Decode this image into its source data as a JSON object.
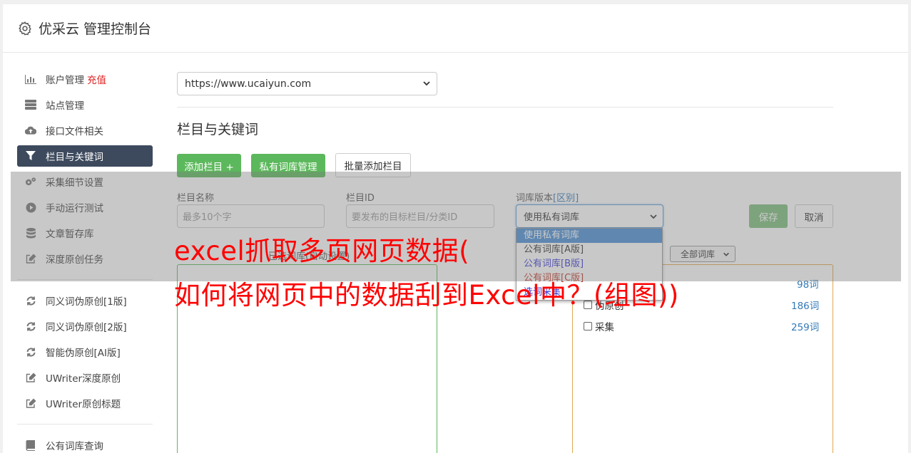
{
  "header": {
    "title": "优采云 管理控制台",
    "icon": "gear-icon"
  },
  "sidebar": {
    "group1": [
      {
        "label": "账户管理",
        "badge": "充值",
        "icon": "bar-chart-icon"
      },
      {
        "label": "站点管理",
        "icon": "server-icon"
      },
      {
        "label": "接口文件相关",
        "icon": "cloud-upload-icon"
      },
      {
        "label": "栏目与关键词",
        "icon": "filter-icon",
        "active": true
      },
      {
        "label": "采集细节设置",
        "icon": "gears-icon"
      },
      {
        "label": "手动运行测试",
        "icon": "play-circle-icon"
      },
      {
        "label": "文章暂存库",
        "icon": "database-icon"
      },
      {
        "label": "深度原创任务",
        "icon": "edit-icon"
      }
    ],
    "group2": [
      {
        "label": "同义词伪原创[1版]",
        "icon": "refresh-icon"
      },
      {
        "label": "同义词伪原创[2版]",
        "icon": "refresh-icon"
      },
      {
        "label": "智能伪原创[AI版]",
        "icon": "refresh-icon"
      },
      {
        "label": "UWriter深度原创",
        "icon": "edit-icon"
      },
      {
        "label": "UWriter原创标题",
        "icon": "edit-icon"
      }
    ],
    "group3": [
      {
        "label": "公有词库查询",
        "icon": "book-icon"
      }
    ]
  },
  "site_select": {
    "value": "https://www.ucaiyun.com"
  },
  "section": {
    "title": "栏目与关键词"
  },
  "buttons": {
    "add_column": "添加栏目 +",
    "private_lib": "私有词库管理",
    "batch_add": "批量添加栏目",
    "save": "保存",
    "cancel": "取消"
  },
  "form": {
    "name_label": "栏目名称",
    "name_placeholder": "最多10个字",
    "id_label": "栏目ID",
    "id_placeholder": "要发布的目标栏目/分类ID",
    "version_label": "词库版本",
    "version_link": "[区别]",
    "version_value": "使用私有词库",
    "version_options": [
      "使用私有词库",
      "公有词库[A版]",
      "公有词库[B版]",
      "公有词库[C版]",
      "选词采集"
    ]
  },
  "selected_panel": {
    "label": "已选词库(自动设置)"
  },
  "lib_filter": {
    "value": "全部词库"
  },
  "libraries": [
    {
      "name": "",
      "count": "98词"
    },
    {
      "name": "伪原创",
      "count": "186词"
    },
    {
      "name": "采集",
      "count": "259词"
    }
  ],
  "headline": {
    "line1": "excel抓取多页网页数据(",
    "line2": "如何将网页中的数据刮到Excel中？(组图))"
  },
  "colors": {
    "active_nav": "#3d4a5d",
    "green": "#5cb85c",
    "headline": "#ff0000",
    "recharge": "#e02020"
  }
}
